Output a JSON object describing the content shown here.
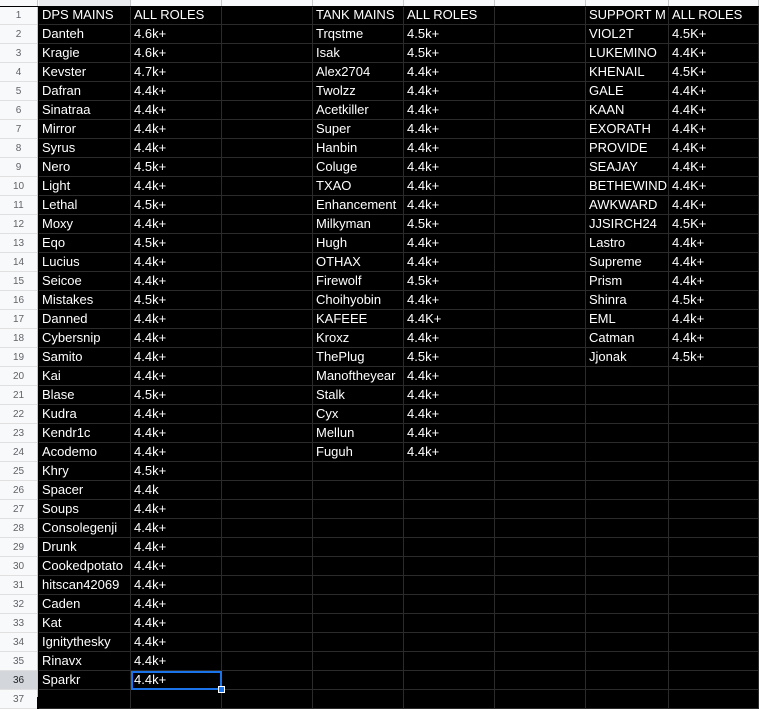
{
  "app": {
    "type": "spreadsheet",
    "background_color": "#000000",
    "text_color": "#ffffff",
    "header_bg_color": "#f8f9fa",
    "selection_color": "#1a73e8"
  },
  "row_numbers": [
    1,
    2,
    3,
    4,
    5,
    6,
    7,
    8,
    9,
    10,
    11,
    12,
    13,
    14,
    15,
    16,
    17,
    18,
    19,
    20,
    21,
    22,
    23,
    24,
    25,
    26,
    27,
    28,
    29,
    30,
    31,
    32,
    33,
    34,
    35,
    36,
    37
  ],
  "selected": {
    "row": 36,
    "column": "B",
    "value": "4.4k+"
  },
  "columns": {
    "a": "dps_name",
    "b": "dps_rank",
    "c": "spacer",
    "d": "tank_name",
    "e": "tank_rank",
    "f": "spacer",
    "g": "support_name",
    "h": "support_rank"
  },
  "headers": {
    "dps_mains": "DPS MAINS",
    "dps_roles": "ALL ROLES",
    "tank_mains": "TANK MAINS",
    "tank_roles": "ALL ROLES",
    "support_mains": "SUPPORT M",
    "support_roles": "ALL ROLES"
  },
  "dps": [
    {
      "name": "Danteh",
      "rank": "4.6k+"
    },
    {
      "name": "Kragie",
      "rank": "4.6k+"
    },
    {
      "name": "Kevster",
      "rank": "4.7k+"
    },
    {
      "name": "Dafran",
      "rank": "4.4k+"
    },
    {
      "name": "Sinatraa",
      "rank": "4.4k+"
    },
    {
      "name": "Mirror",
      "rank": "4.4k+"
    },
    {
      "name": "Syrus",
      "rank": "4.4k+"
    },
    {
      "name": "Nero",
      "rank": "4.5k+"
    },
    {
      "name": "Light",
      "rank": "4.4k+"
    },
    {
      "name": "Lethal",
      "rank": "4.5k+"
    },
    {
      "name": "Moxy",
      "rank": "4.4k+"
    },
    {
      "name": "Eqo",
      "rank": "4.5k+"
    },
    {
      "name": "Lucius",
      "rank": "4.4k+"
    },
    {
      "name": "Seicoe",
      "rank": "4.4k+"
    },
    {
      "name": "Mistakes",
      "rank": "4.5k+"
    },
    {
      "name": "Danned",
      "rank": "4.4k+"
    },
    {
      "name": "Cybersnip",
      "rank": "4.4k+"
    },
    {
      "name": "Samito",
      "rank": "4.4k+"
    },
    {
      "name": "Kai",
      "rank": "4.4k+"
    },
    {
      "name": "Blase",
      "rank": "4.5k+"
    },
    {
      "name": "Kudra",
      "rank": "4.4k+"
    },
    {
      "name": "Kendr1c",
      "rank": "4.4k+"
    },
    {
      "name": "Acodemo",
      "rank": "4.4k+"
    },
    {
      "name": "Khry",
      "rank": "4.5k+"
    },
    {
      "name": "Spacer",
      "rank": "4.4k"
    },
    {
      "name": "Soups",
      "rank": "4.4k+"
    },
    {
      "name": "Consolegenji",
      "rank": "4.4k+"
    },
    {
      "name": "Drunk",
      "rank": "4.4k+"
    },
    {
      "name": "Cookedpotato",
      "rank": "4.4k+"
    },
    {
      "name": "hitscan42069",
      "rank": "4.4k+"
    },
    {
      "name": "Caden",
      "rank": "4.4k+"
    },
    {
      "name": "Kat",
      "rank": "4.4k+"
    },
    {
      "name": "Ignitythesky",
      "rank": "4.4k+"
    },
    {
      "name": "Rinavx",
      "rank": "4.4k+"
    },
    {
      "name": "Sparkr",
      "rank": "4.4k+"
    }
  ],
  "tank": [
    {
      "name": "Trqstme",
      "rank": "4.5k+"
    },
    {
      "name": "Isak",
      "rank": "4.5k+"
    },
    {
      "name": "Alex2704",
      "rank": "4.4k+"
    },
    {
      "name": "Twolzz",
      "rank": "4.4k+"
    },
    {
      "name": "Acetkiller",
      "rank": "4.4k+"
    },
    {
      "name": "Super",
      "rank": "4.4k+"
    },
    {
      "name": "Hanbin",
      "rank": "4.4k+"
    },
    {
      "name": "Coluge",
      "rank": "4.4k+"
    },
    {
      "name": "TXAO",
      "rank": "4.4k+"
    },
    {
      "name": "Enhancement",
      "rank": "4.4k+"
    },
    {
      "name": "Milkyman",
      "rank": "4.5k+"
    },
    {
      "name": "Hugh",
      "rank": "4.4k+"
    },
    {
      "name": "OTHAX",
      "rank": "4.4k+"
    },
    {
      "name": "Firewolf",
      "rank": "4.5k+"
    },
    {
      "name": "Choihyobin",
      "rank": "4.4k+"
    },
    {
      "name": "KAFEEE",
      "rank": "4.4K+"
    },
    {
      "name": "Kroxz",
      "rank": "4.4k+"
    },
    {
      "name": "ThePlug",
      "rank": "4.5k+"
    },
    {
      "name": "Manoftheyear",
      "rank": "4.4k+"
    },
    {
      "name": "Stalk",
      "rank": "4.4k+"
    },
    {
      "name": "Cyx",
      "rank": "4.4k+"
    },
    {
      "name": "Mellun",
      "rank": "4.4k+"
    },
    {
      "name": "Fuguh",
      "rank": "4.4k+"
    }
  ],
  "support": [
    {
      "name": "VIOL2T",
      "rank": "4.5K+"
    },
    {
      "name": "LUKEMINO",
      "rank": "4.4K+"
    },
    {
      "name": "KHENAIL",
      "rank": "4.5K+"
    },
    {
      "name": "GALE",
      "rank": "4.4K+"
    },
    {
      "name": "KAAN",
      "rank": "4.4K+"
    },
    {
      "name": "EXORATH",
      "rank": "4.4K+"
    },
    {
      "name": "PROVIDE",
      "rank": "4.4K+"
    },
    {
      "name": "SEAJAY",
      "rank": "4.4K+"
    },
    {
      "name": "BETHEWIND",
      "rank": "4.4K+"
    },
    {
      "name": "AWKWARD",
      "rank": "4.4K+"
    },
    {
      "name": "JJSIRCH24",
      "rank": "4.5K+"
    },
    {
      "name": "Lastro",
      "rank": "4.4k+"
    },
    {
      "name": "Supreme",
      "rank": "4.4k+"
    },
    {
      "name": "Prism",
      "rank": "4.4k+"
    },
    {
      "name": "Shinra",
      "rank": "4.5k+"
    },
    {
      "name": "EML",
      "rank": "4.4k+"
    },
    {
      "name": "Catman",
      "rank": "4.4k+"
    },
    {
      "name": "Jjonak",
      "rank": "4.5k+"
    }
  ]
}
